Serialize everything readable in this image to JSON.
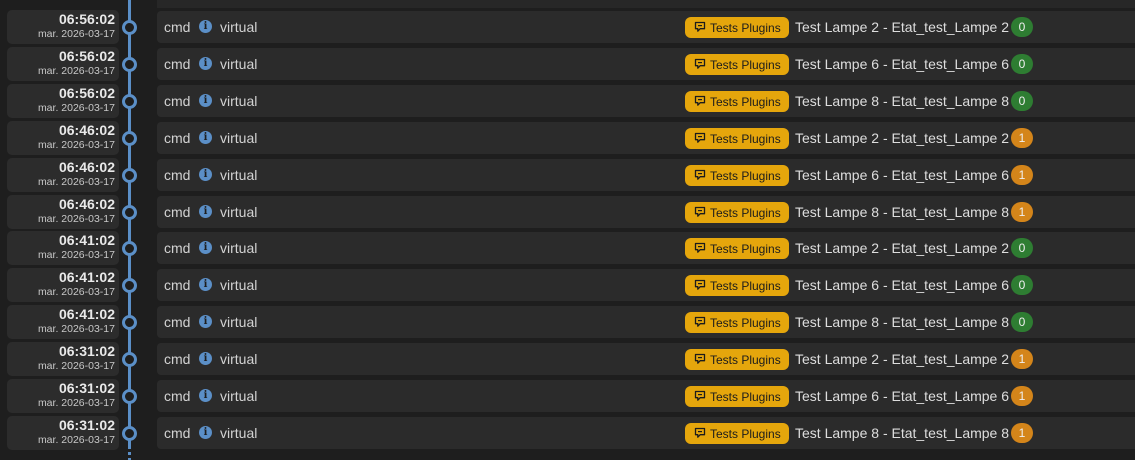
{
  "timeline": {
    "entries": [
      {
        "time": "06:56:02",
        "date": "mar. 2026-03-17",
        "type": "cmd",
        "plugin": "virtual",
        "tag": "Tests Plugins",
        "name": "Test Lampe 2 - Etat_test_Lampe 2",
        "value": "0",
        "value_color": "#2e7d32"
      },
      {
        "time": "06:56:02",
        "date": "mar. 2026-03-17",
        "type": "cmd",
        "plugin": "virtual",
        "tag": "Tests Plugins",
        "name": "Test Lampe 6 - Etat_test_Lampe 6",
        "value": "0",
        "value_color": "#2e7d32"
      },
      {
        "time": "06:56:02",
        "date": "mar. 2026-03-17",
        "type": "cmd",
        "plugin": "virtual",
        "tag": "Tests Plugins",
        "name": "Test Lampe 8 - Etat_test_Lampe 8",
        "value": "0",
        "value_color": "#2e7d32"
      },
      {
        "time": "06:46:02",
        "date": "mar. 2026-03-17",
        "type": "cmd",
        "plugin": "virtual",
        "tag": "Tests Plugins",
        "name": "Test Lampe 2 - Etat_test_Lampe 2",
        "value": "1",
        "value_color": "#d4851a"
      },
      {
        "time": "06:46:02",
        "date": "mar. 2026-03-17",
        "type": "cmd",
        "plugin": "virtual",
        "tag": "Tests Plugins",
        "name": "Test Lampe 6 - Etat_test_Lampe 6",
        "value": "1",
        "value_color": "#d4851a"
      },
      {
        "time": "06:46:02",
        "date": "mar. 2026-03-17",
        "type": "cmd",
        "plugin": "virtual",
        "tag": "Tests Plugins",
        "name": "Test Lampe 8 - Etat_test_Lampe 8",
        "value": "1",
        "value_color": "#d4851a"
      },
      {
        "time": "06:41:02",
        "date": "mar. 2026-03-17",
        "type": "cmd",
        "plugin": "virtual",
        "tag": "Tests Plugins",
        "name": "Test Lampe 2 - Etat_test_Lampe 2",
        "value": "0",
        "value_color": "#2e7d32"
      },
      {
        "time": "06:41:02",
        "date": "mar. 2026-03-17",
        "type": "cmd",
        "plugin": "virtual",
        "tag": "Tests Plugins",
        "name": "Test Lampe 6 - Etat_test_Lampe 6",
        "value": "0",
        "value_color": "#2e7d32"
      },
      {
        "time": "06:41:02",
        "date": "mar. 2026-03-17",
        "type": "cmd",
        "plugin": "virtual",
        "tag": "Tests Plugins",
        "name": "Test Lampe 8 - Etat_test_Lampe 8",
        "value": "0",
        "value_color": "#2e7d32"
      },
      {
        "time": "06:31:02",
        "date": "mar. 2026-03-17",
        "type": "cmd",
        "plugin": "virtual",
        "tag": "Tests Plugins",
        "name": "Test Lampe 2 - Etat_test_Lampe 2",
        "value": "1",
        "value_color": "#d4851a"
      },
      {
        "time": "06:31:02",
        "date": "mar. 2026-03-17",
        "type": "cmd",
        "plugin": "virtual",
        "tag": "Tests Plugins",
        "name": "Test Lampe 6 - Etat_test_Lampe 6",
        "value": "1",
        "value_color": "#d4851a"
      },
      {
        "time": "06:31:02",
        "date": "mar. 2026-03-17",
        "type": "cmd",
        "plugin": "virtual",
        "tag": "Tests Plugins",
        "name": "Test Lampe 8 - Etat_test_Lampe 8",
        "value": "1",
        "value_color": "#d4851a"
      }
    ],
    "colors": {
      "accent": "#5b8fc7",
      "tag_background": "#e5a60c",
      "card_background": "#2b2b2b",
      "page_background": "#1e1e1e"
    },
    "icons": {
      "info": "info-icon",
      "tag": "comment-icon"
    }
  }
}
